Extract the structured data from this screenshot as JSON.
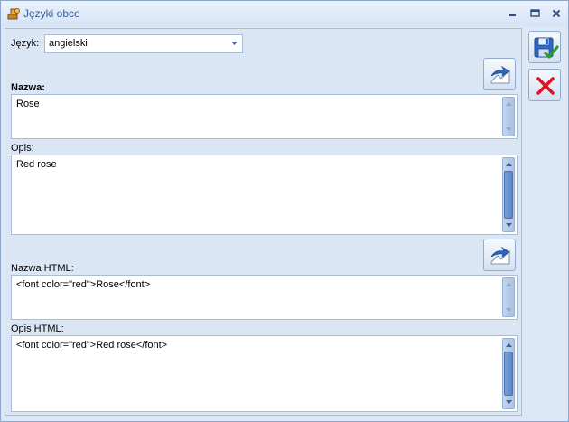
{
  "window": {
    "title": "Języki obce",
    "minimize_symbol": "‗",
    "maximize_symbol": "▭",
    "close_symbol": "✕"
  },
  "language": {
    "label": "Język:",
    "value": "angielski"
  },
  "name": {
    "label": "Nazwa:",
    "value": "Rose"
  },
  "description": {
    "label": "Opis:",
    "value": "Red rose"
  },
  "name_html": {
    "label": "Nazwa HTML:",
    "value": "<font color=\"red\">Rose</font>"
  },
  "description_html": {
    "label": "Opis HTML:",
    "value": "<font color=\"red\">Red rose</font>"
  },
  "icons": {
    "app": "app-icon",
    "translate": "translate-icon",
    "save": "save-icon",
    "cancel": "cancel-icon"
  },
  "colors": {
    "accent": "#37609a",
    "cancel_red": "#e0141e",
    "confirm_green": "#2a9d2a"
  }
}
